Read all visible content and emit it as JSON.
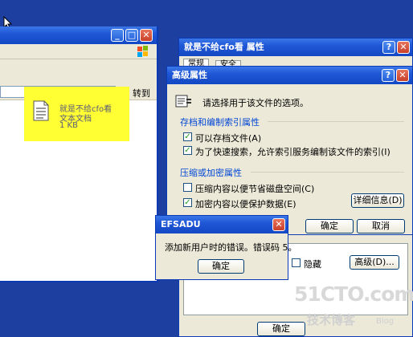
{
  "explorer": {
    "goto_label": "转到",
    "file": {
      "name": "就是不给cfo看",
      "type": "文本文档",
      "size": "1 KB"
    }
  },
  "props": {
    "title": "就是不给cfo看 属性",
    "tabs": [
      "常规",
      "安全"
    ],
    "hidden_label": "隐藏",
    "advanced_button": "高级(D)...",
    "ok_label": "确定"
  },
  "adv": {
    "title": "高级属性",
    "intro": "请选择用于该文件的选项。",
    "group_archive": "存档和编制索引属性",
    "chk_archive": "可以存档文件(A)",
    "chk_index": "为了快速搜索，允许索引服务编制该文件的索引(I)",
    "group_compress": "压缩或加密属性",
    "chk_compress": "压缩内容以便节省磁盘空间(C)",
    "chk_encrypt": "加密内容以便保护数据(E)",
    "details_button": "详细信息(D)",
    "ok_label": "确定",
    "cancel_label": "取消"
  },
  "error": {
    "title": "EFSADU",
    "message": "添加新用户时的错误。错误码 5。",
    "ok_label": "确定"
  },
  "watermark": {
    "brand": "51CTO.com",
    "sub": "技术博客",
    "blog": "Blog"
  }
}
